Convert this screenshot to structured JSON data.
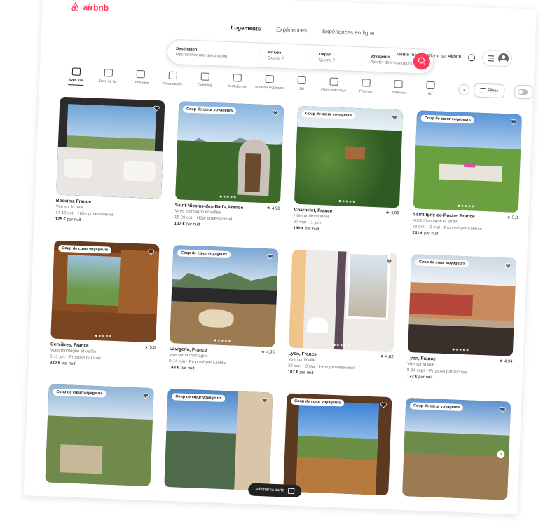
{
  "header": {
    "logo_text": "airbnb",
    "tabs": [
      "Logements",
      "Expériences",
      "Expériences en ligne"
    ],
    "host_link": "Mettre mon logement sur Airbnb"
  },
  "search": {
    "destination_label": "Destination",
    "destination_placeholder": "Rechercher une destination",
    "checkin_label": "Arrivée",
    "checkin_value": "Quand ?",
    "checkout_label": "Départ",
    "checkout_value": "Quand ?",
    "guests_label": "Voyageurs",
    "guests_placeholder": "Ajouter des voyageurs"
  },
  "categories": [
    {
      "label": "Avec vue",
      "icon": "view-icon",
      "active": true
    },
    {
      "label": "Bord de lac",
      "icon": "lake-icon",
      "active": false
    },
    {
      "label": "Campagne",
      "icon": "countryside-icon",
      "active": false
    },
    {
      "label": "Nouveautés",
      "icon": "new-icon",
      "active": false
    },
    {
      "label": "Camping",
      "icon": "camping-icon",
      "active": false
    },
    {
      "label": "Bord de mer",
      "icon": "beach-icon",
      "active": false
    },
    {
      "label": "Sous les tropiques",
      "icon": "tropical-icon",
      "active": false
    },
    {
      "label": "Ski",
      "icon": "ski-icon",
      "active": false
    },
    {
      "label": "Parcs nationaux",
      "icon": "park-icon",
      "active": false
    },
    {
      "label": "Piscines",
      "icon": "pool-icon",
      "active": false
    },
    {
      "label": "Containers",
      "icon": "container-icon",
      "active": false
    },
    {
      "label": "Bo",
      "icon": "bo-icon",
      "active": false
    }
  ],
  "filters_label": "Filtres",
  "map_button": "Afficher la carte",
  "listings": [
    {
      "badge": "",
      "place": "Bossieu, France",
      "line2": "Vue sur la baie",
      "line3": "14-19 oct. · Hôte professionnel",
      "price": "125 €",
      "price_suffix": "par nuit",
      "rating": ""
    },
    {
      "badge": "Coup de cœur voyageurs",
      "place": "Saint-Nicolas-des-Biefs, France",
      "line2": "Vues montagne et vallée",
      "line3": "15-20 oct. · Hôte professionnel",
      "price": "107 €",
      "price_suffix": "par nuit",
      "rating": "4,98"
    },
    {
      "badge": "Coup de cœur voyageurs",
      "place": "Charnelet, France",
      "line2": "Hôte professionnel",
      "line3": "27 mai – 1 juin",
      "price": "196 €",
      "price_suffix": "par nuit",
      "rating": "4,96"
    },
    {
      "badge": "Coup de cœur voyageurs",
      "place": "Saint-Igny-de-Roche, France",
      "line2": "Vues montagne et jardin",
      "line3": "28 avr. – 3 mai · Proposé par Fabrice",
      "price": "241 €",
      "price_suffix": "par nuit",
      "rating": "5,0"
    },
    {
      "badge": "Coup de cœur voyageurs",
      "place": "Cervières, France",
      "line2": "Vues montagne et vallée",
      "line3": "6-11 juil. · Proposé par Loïc",
      "price": "220 €",
      "price_suffix": "par nuit",
      "rating": "5,0"
    },
    {
      "badge": "Coup de cœur voyageurs",
      "place": "Lavigerie, France",
      "line2": "Vue sur la montagne",
      "line3": "9-14 juin · Proposé par Laetitia",
      "price": "148 €",
      "price_suffix": "par nuit",
      "rating": "4,95"
    },
    {
      "badge": "",
      "place": "Lyon, France",
      "line2": "Vue sur la ville",
      "line3": "26 avr. – 3 mai · Hôte professionnel",
      "price": "107 €",
      "price_suffix": "par nuit",
      "rating": "4,82"
    },
    {
      "badge": "Coup de cœur voyageurs",
      "place": "Lyon, France",
      "line2": "Vue sur la ville",
      "line3": "9-14 sept. · Proposé par Nicolas",
      "price": "122 €",
      "price_suffix": "par nuit",
      "rating": "4,94"
    },
    {
      "badge": "Coup de cœur voyageurs",
      "place": "",
      "line2": "",
      "line3": "",
      "price": "",
      "price_suffix": "",
      "rating": ""
    },
    {
      "badge": "Coup de cœur voyageurs",
      "place": "",
      "line2": "",
      "line3": "",
      "price": "",
      "price_suffix": "",
      "rating": ""
    },
    {
      "badge": "Coup de cœur voyageurs",
      "place": "",
      "line2": "",
      "line3": "",
      "price": "",
      "price_suffix": "",
      "rating": ""
    },
    {
      "badge": "Coup de cœur voyageurs",
      "place": "",
      "line2": "",
      "line3": "",
      "price": "",
      "price_suffix": "",
      "rating": ""
    }
  ],
  "colors": {
    "brand": "#ff385c"
  }
}
